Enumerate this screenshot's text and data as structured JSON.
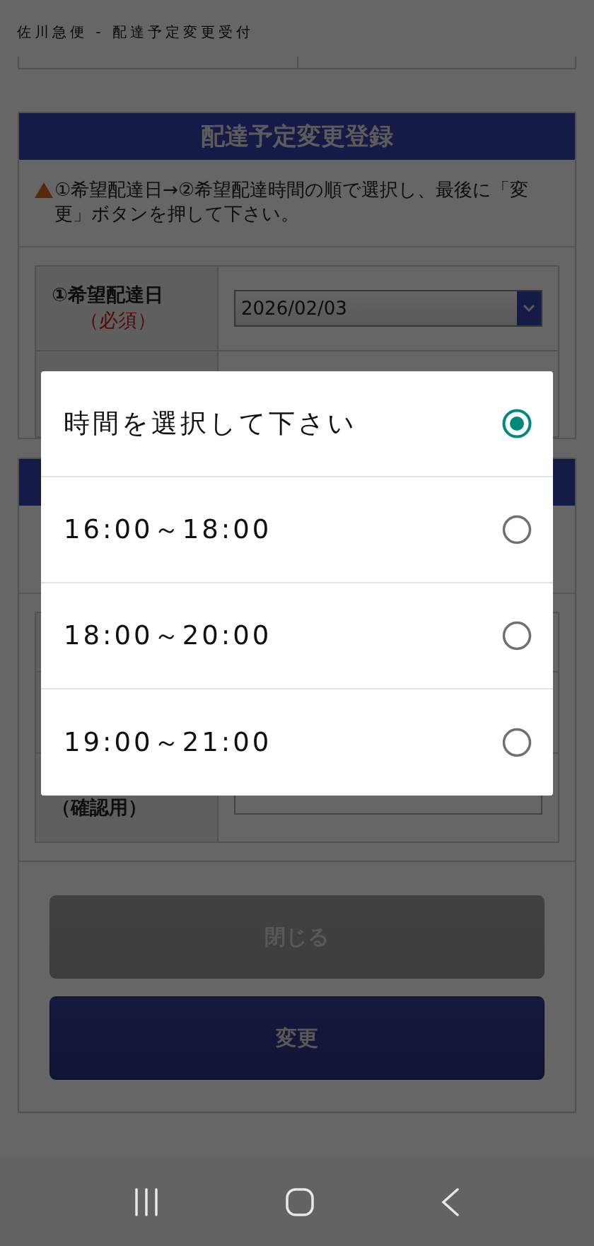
{
  "page_title": "佐川急便 - 配達予定変更受付",
  "change_section": {
    "title": "配達予定変更登録",
    "notice": "①希望配達日→②希望配達時間の順で選択し、最後に「変更」ボタンを押して下さい。",
    "date_field": {
      "label": "①希望配達日",
      "required": "（必須）",
      "value": "2026/02/03"
    }
  },
  "email_section": {
    "confirm_label": "（確認用）"
  },
  "buttons": [
    {
      "label": "閉じる",
      "kind": "secondary"
    },
    {
      "label": "変更",
      "kind": "primary"
    }
  ],
  "dialog": {
    "options": [
      {
        "label": "時間を選択して下さい",
        "selected": true
      },
      {
        "label": "16:00～18:00",
        "selected": false
      },
      {
        "label": "18:00～20:00",
        "selected": false
      },
      {
        "label": "19:00～21:00",
        "selected": false
      }
    ]
  }
}
